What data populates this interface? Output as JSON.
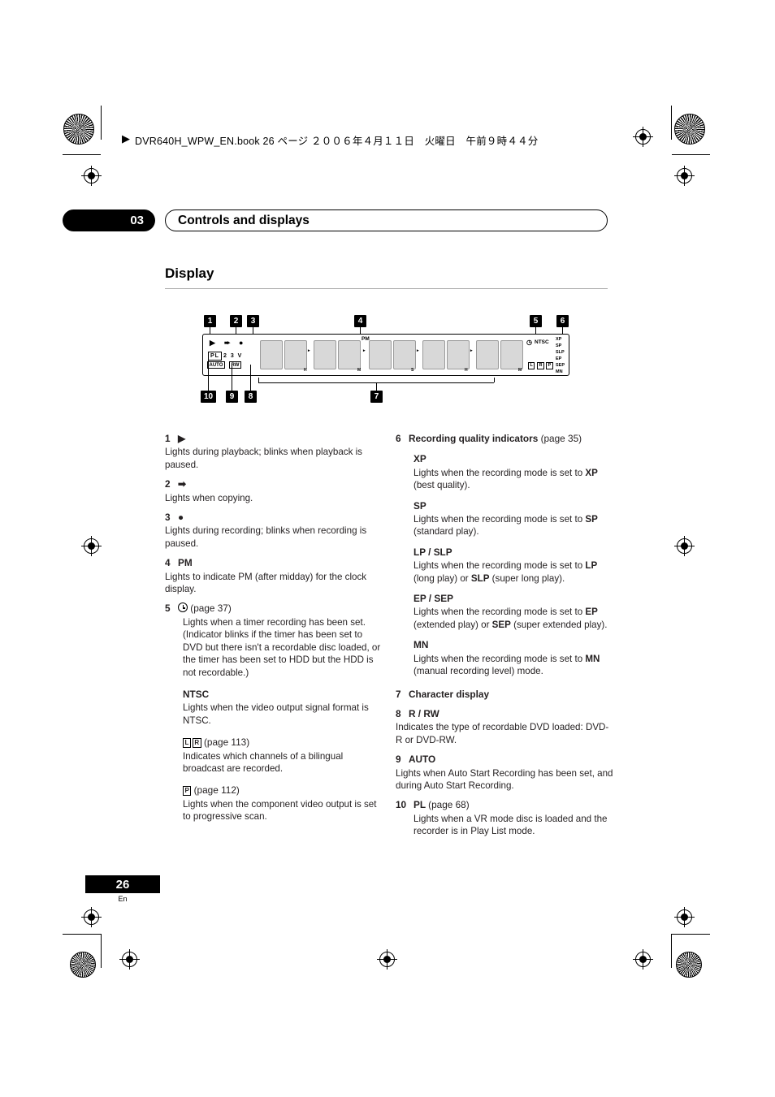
{
  "header": {
    "text": "DVR640H_WPW_EN.book  26 ページ  ２００６年４月１１日　火曜日　午前９時４４分",
    "arrow": "▶"
  },
  "chapter": {
    "number": "03",
    "title": "Controls and displays"
  },
  "section": {
    "heading": "Display"
  },
  "figure": {
    "callouts": [
      "1",
      "2",
      "3",
      "4",
      "5",
      "6",
      "7",
      "8",
      "9",
      "10"
    ],
    "panel_labels": {
      "play": "▶",
      "copy": "➡",
      "record": "●",
      "pl": "PL",
      "two_three_v": "2 3 V",
      "auto": "AUTO",
      "rw": "RW",
      "pm": "PM",
      "ntsc": "NTSC",
      "l": "L",
      "r": "R",
      "p": "P",
      "xp": "XP",
      "sp": "SP",
      "slp": "SLP",
      "ep": "EP",
      "sep": "SEP",
      "mn": "MN",
      "h1": "H",
      "m1": "M",
      "s": "S",
      "h2": "H",
      "m2": "M"
    }
  },
  "left_column": [
    {
      "num": "1",
      "title": "▶",
      "body": "Lights during playback; blinks when playback is paused."
    },
    {
      "num": "2",
      "title": "➡",
      "body": "Lights when copying."
    },
    {
      "num": "3",
      "title": "●",
      "body": "Lights during recording; blinks when recording is paused."
    },
    {
      "num": "4",
      "title": "PM",
      "body": "Lights to indicate PM (after midday) for the clock display."
    },
    {
      "num": "5",
      "title": "(page 37)",
      "body": "Lights when a timer recording has been set. (Indicator blinks if the timer has been set to DVD but there isn't a recordable disc loaded, or the timer has been set to HDD but the HDD is not recordable.)"
    }
  ],
  "left_subitems": [
    {
      "title": "NTSC",
      "body": "Lights when the video output signal format is NTSC."
    },
    {
      "title": "(page 113)",
      "body": "Indicates which channels of a bilingual broadcast are recorded."
    },
    {
      "title": "(page 112)",
      "body": "Lights when the component video output is set to progressive scan."
    }
  ],
  "right_column": {
    "item6": {
      "num": "6",
      "title": "Recording quality indicators",
      "page": "(page 35)",
      "subitems": [
        {
          "title": "XP",
          "body_pre": "Lights when the recording mode is set to ",
          "body_bold": "XP",
          "body_post": " (best quality)."
        },
        {
          "title": "SP",
          "body_pre": "Lights when the recording mode is set to ",
          "body_bold": "SP",
          "body_post": " (standard play)."
        },
        {
          "title": "LP / SLP",
          "body_pre": "Lights when the recording mode is set to ",
          "body_bold": "LP",
          "body_mid": " (long play) or ",
          "body_bold2": "SLP",
          "body_post": " (super long play)."
        },
        {
          "title": "EP / SEP",
          "body_pre": "Lights when the recording mode is set to ",
          "body_bold": "EP",
          "body_mid": " (extended play) or ",
          "body_bold2": "SEP",
          "body_post": " (super extended play)."
        },
        {
          "title": "MN",
          "body_pre": "Lights when the recording mode is set to ",
          "body_bold": "MN",
          "body_post": " (manual recording level) mode."
        }
      ]
    },
    "item7": {
      "num": "7",
      "title": "Character display"
    },
    "item8": {
      "num": "8",
      "title": "R / RW",
      "body": "Indicates the type of recordable DVD loaded: DVD-R or DVD-RW."
    },
    "item9": {
      "num": "9",
      "title": "AUTO",
      "body": "Lights when Auto Start Recording has been set, and during Auto Start Recording."
    },
    "item10": {
      "num": "10",
      "title": "PL",
      "page": "(page 68)",
      "body": "Lights when a VR mode disc is loaded and the recorder is in Play List mode."
    }
  },
  "footer": {
    "page": "26",
    "lang": "En"
  }
}
